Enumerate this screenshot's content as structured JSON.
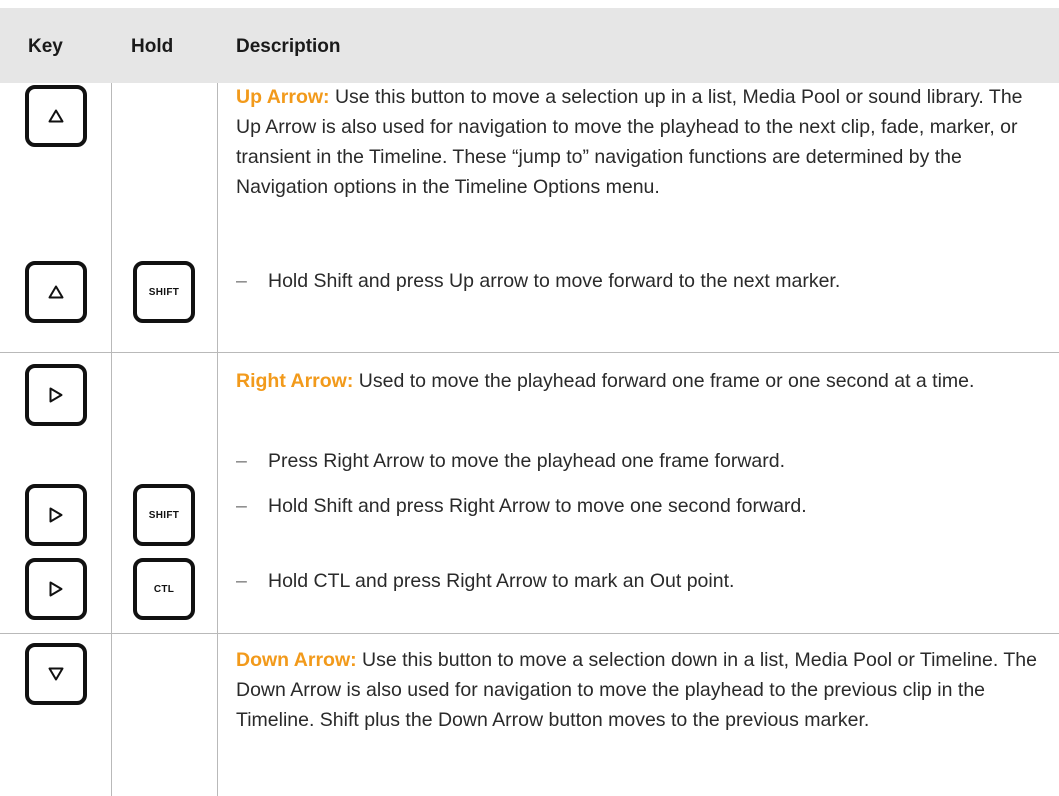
{
  "table": {
    "headers": {
      "key": "Key",
      "hold": "Hold",
      "description": "Description"
    },
    "rows": [
      {
        "lead": "Up Arrow:",
        "text": " Use this button to move a selection up in a list, Media Pool or sound library. The Up Arrow is also used for navigation to move the playhead to the next clip, fade, marker, or transient in the Timeline. These “jump to” navigation functions are determined by the Navigation options in the Timeline Options menu.",
        "bullets": [
          {
            "dash": "–",
            "text": "Hold Shift and press Up arrow to move forward to the next marker.",
            "hold_label": "SHIFT"
          }
        ]
      },
      {
        "lead": "Right Arrow:",
        "text": " Used to move the playhead forward one frame or one second at a time.",
        "bullets": [
          {
            "dash": "–",
            "text": "Press Right Arrow to move the playhead one frame forward."
          },
          {
            "dash": "–",
            "text": "Hold Shift and press Right Arrow to move one second forward.",
            "hold_label": "SHIFT"
          },
          {
            "dash": "–",
            "text": "Hold CTL and press Right Arrow to mark an Out point.",
            "hold_label": "CTL"
          }
        ]
      },
      {
        "lead": "Down Arrow:",
        "text": " Use this button to move a selection down in a list, Media Pool or Timeline. The Down Arrow is also used for navigation to move the playhead to the previous clip in the Timeline. Shift plus the Down Arrow button moves to the previous marker."
      }
    ]
  },
  "icons": {
    "up": "up-triangle-icon",
    "right": "right-triangle-icon",
    "down": "down-triangle-icon"
  },
  "colors": {
    "header_bg": "#e6e6e6",
    "lead": "#f29a1b",
    "rule": "#b9b9b9"
  }
}
